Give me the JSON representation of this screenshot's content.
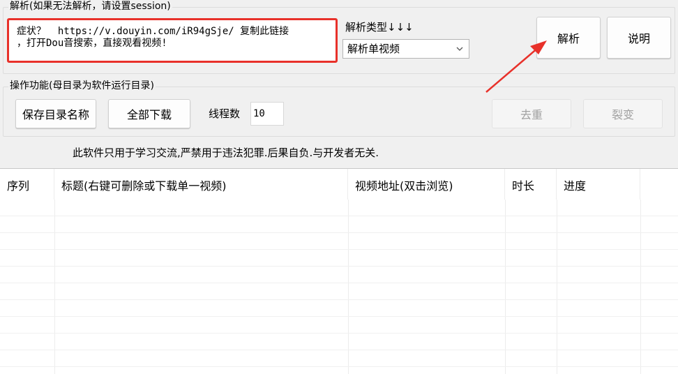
{
  "parse_group": {
    "legend": "解析(如果无法解析，请设置session)",
    "url_input_value": "症状？  https://v.douyin.com/iR94gSje/ 复制此链接\n，打开Dou音搜索，直接观看视频!",
    "parse_type_label": "解析类型↓↓↓",
    "parse_type_selected": "解析单视频",
    "parse_button": "解析",
    "help_button": "说明"
  },
  "ops_group": {
    "legend": "操作功能(母目录为软件运行目录)",
    "save_dir_button": "保存目录名称",
    "download_all_button": "全部下载",
    "threads_label": "线程数",
    "threads_value": "10",
    "dedupe_button": "去重",
    "split_button": "裂变"
  },
  "disclaimer": "此软件只用于学习交流,严禁用于违法犯罪.后果自负.与开发者无关.",
  "table": {
    "columns": [
      "序列",
      "标题(右键可删除或下载单一视频)",
      "视频地址(双击浏览)",
      "时长",
      "进度"
    ],
    "rows": []
  },
  "colors": {
    "highlight_red": "#e8312a",
    "window_bg": "#f0f0f0"
  },
  "icons": [
    "chevron-down-icon",
    "annotation-arrow"
  ]
}
